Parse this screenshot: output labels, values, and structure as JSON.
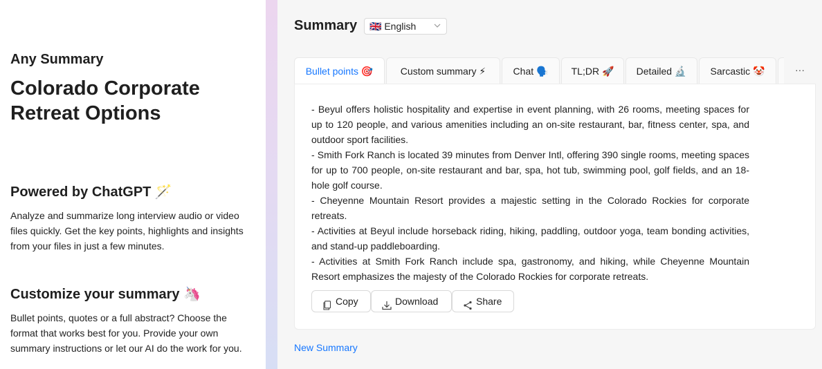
{
  "left": {
    "app_name": "Any Summary",
    "doc_title": "Colorado Corporate Retreat Options",
    "features": [
      {
        "title": "Powered by ChatGPT 🪄",
        "text": "Analyze and summarize long interview audio or video files quickly. Get the key points, highlights and insights from your files in just a few minutes."
      },
      {
        "title": "Customize your summary 🦄",
        "text": "Bullet points, quotes or a full abstract? Choose the format that works best for you. Provide your own summary instructions or let our AI do the work for you."
      }
    ]
  },
  "right": {
    "summary_label": "Summary",
    "language": "🇬🇧 English",
    "tabs": [
      {
        "label": "Bullet points 🎯"
      },
      {
        "label": "Custom summary ⚡"
      },
      {
        "label": "Chat 🗣️"
      },
      {
        "label": "TL;DR 🚀"
      },
      {
        "label": "Detailed 🔬"
      },
      {
        "label": "Sarcastic 🤡"
      }
    ],
    "more_label": "···",
    "bullets": [
      "- Beyul offers holistic hospitality and expertise in event planning, with 26 rooms, meeting spaces for up to 120 people, and various amenities including an on-site restaurant, bar, fitness center, spa, and outdoor sport facilities.",
      "- Smith Fork Ranch is located 39 minutes from Denver Intl, offering 390 single rooms, meeting spaces for up to 700 people, on-site restaurant and bar, spa, hot tub, swimming pool, golf fields, and an 18-hole golf course.",
      "- Cheyenne Mountain Resort provides a majestic setting in the Colorado Rockies for corporate retreats.",
      "- Activities at Beyul include horseback riding, hiking, paddling, outdoor yoga, team bonding activities, and stand-up paddleboarding.",
      "- Activities at Smith Fork Ranch include spa, gastronomy, and hiking, while Cheyenne Mountain Resort emphasizes the majesty of the Colorado Rockies for corporate retreats."
    ],
    "buttons": {
      "copy": "Copy",
      "download": "Download",
      "share": "Share"
    },
    "new_summary": "New Summary"
  },
  "colors": {
    "accent": "#1677ff",
    "panel_bg": "#f6f6f6",
    "strip_top": "#ecd6ef",
    "strip_bottom": "#d7def5"
  },
  "icons": {
    "language_chevron": "chevron-down-icon",
    "copy": "copy-icon",
    "download": "download-icon",
    "share": "share-icon"
  }
}
